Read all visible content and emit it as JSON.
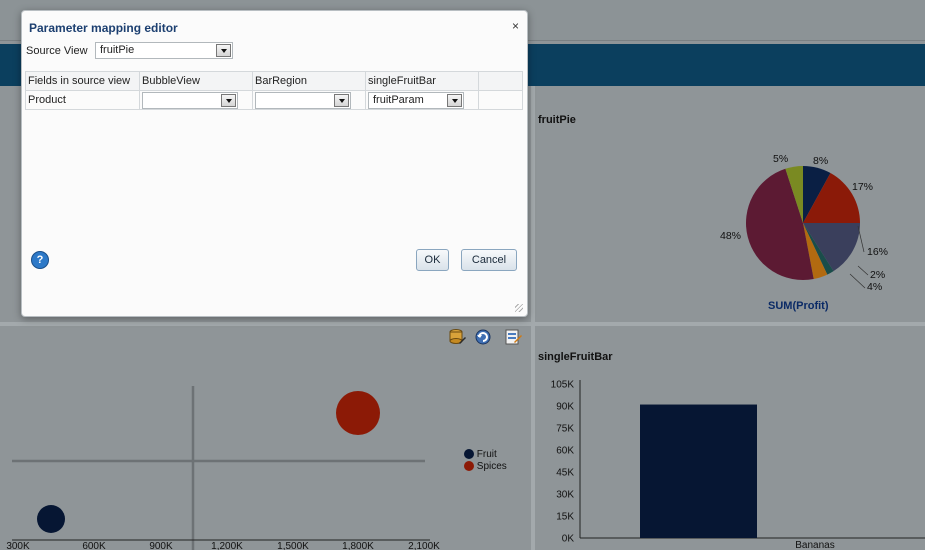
{
  "dialog": {
    "title": "Parameter mapping editor",
    "close_label": "×",
    "source_view_label": "Source View",
    "source_view_value": "fruitPie",
    "table": {
      "headers": [
        "Fields in source view",
        "BubbleView",
        "BarRegion",
        "singleFruitBar"
      ],
      "rows": [
        {
          "field": "Product",
          "bubble": "",
          "bar_region": "",
          "single_fruit_bar": "fruitParam"
        }
      ]
    },
    "help_label": "?",
    "ok_label": "OK",
    "cancel_label": "Cancel"
  },
  "pie": {
    "title": "fruitPie",
    "footer": "SUM(Profit)"
  },
  "bar": {
    "title": "singleFruitBar"
  },
  "bubble": {
    "toolbar_icons": [
      "database-edit-icon",
      "refresh-icon",
      "edit-form-icon"
    ]
  },
  "chart_data": [
    {
      "type": "pie",
      "title": "fruitPie",
      "xlabel": "SUM(Profit)",
      "slices": [
        {
          "label": "8%",
          "value": 8,
          "color": "#0a1f44"
        },
        {
          "label": "17%",
          "value": 17,
          "color": "#8b1a08"
        },
        {
          "label": "16%",
          "value": 16,
          "color": "#3a3f5c"
        },
        {
          "label": "2%",
          "value": 2,
          "color": "#1a4d4a"
        },
        {
          "label": "4%",
          "value": 4,
          "color": "#b26a10"
        },
        {
          "label": "48%",
          "value": 48,
          "color": "#5c1a33"
        },
        {
          "label": "5%",
          "value": 5,
          "color": "#7a8a22"
        }
      ]
    },
    {
      "type": "bar",
      "title": "singleFruitBar",
      "categories": [
        "Bananas"
      ],
      "values": [
        91000
      ],
      "ylim": [
        0,
        105000
      ],
      "yticks": [
        "0K",
        "15K",
        "30K",
        "45K",
        "60K",
        "75K",
        "90K",
        "105K"
      ],
      "color": "#061633"
    },
    {
      "type": "scatter",
      "xticks": [
        "300K",
        "600K",
        "900K",
        "1,200K",
        "1,500K",
        "1,800K",
        "2,100K"
      ],
      "series": [
        {
          "name": "Fruit",
          "color": "#061633"
        },
        {
          "name": "Spices",
          "color": "#8c1a06"
        }
      ]
    }
  ]
}
